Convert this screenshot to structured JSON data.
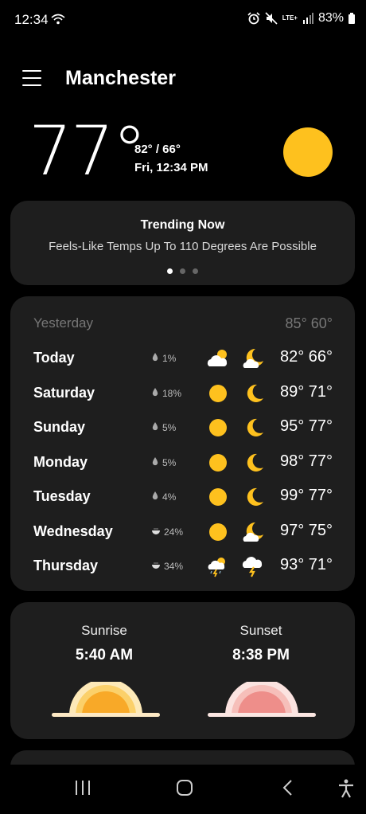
{
  "status": {
    "time": "12:34",
    "lte": "LTE+",
    "battery": "83%"
  },
  "header": {
    "city": "Manchester"
  },
  "current": {
    "temp": "77°",
    "hilo": "82° / 66°",
    "datetime": "Fri, 12:34 PM",
    "icon": "sun-icon"
  },
  "trending": {
    "title": "Trending Now",
    "text": "Feels-Like Temps Up To 110 Degrees Are Possible"
  },
  "forecast": {
    "yesterday": {
      "day": "Yesterday",
      "temps": "85° 60°"
    },
    "days": [
      {
        "day": "Today",
        "precip": "1%",
        "precip_icon": "drop-icon",
        "day_icon": "partly-cloudy-icon",
        "night_icon": "partly-cloudy-night-icon",
        "temps": "82° 66°"
      },
      {
        "day": "Saturday",
        "precip": "18%",
        "precip_icon": "drop-icon",
        "day_icon": "sun-icon",
        "night_icon": "moon-icon",
        "temps": "89° 71°"
      },
      {
        "day": "Sunday",
        "precip": "5%",
        "precip_icon": "drop-icon",
        "day_icon": "sun-icon",
        "night_icon": "moon-icon",
        "temps": "95° 77°"
      },
      {
        "day": "Monday",
        "precip": "5%",
        "precip_icon": "drop-icon",
        "day_icon": "sun-icon",
        "night_icon": "moon-icon",
        "temps": "98° 77°"
      },
      {
        "day": "Tuesday",
        "precip": "4%",
        "precip_icon": "drop-icon",
        "day_icon": "sun-icon",
        "night_icon": "moon-icon",
        "temps": "99° 77°"
      },
      {
        "day": "Wednesday",
        "precip": "24%",
        "precip_icon": "rain-chance-icon",
        "day_icon": "sun-icon",
        "night_icon": "partly-cloudy-night-icon",
        "temps": "97° 75°"
      },
      {
        "day": "Thursday",
        "precip": "34%",
        "precip_icon": "rain-chance-icon",
        "day_icon": "thunderstorm-icon",
        "night_icon": "thunderstorm-night-icon",
        "temps": "93° 71°"
      }
    ]
  },
  "sun": {
    "sunrise_label": "Sunrise",
    "sunrise_time": "5:40 AM",
    "sunset_label": "Sunset",
    "sunset_time": "8:38 PM"
  },
  "colors": {
    "sun": "#FEC11E",
    "card": "#1e1e1e",
    "sunset": "#F0A5A0"
  }
}
